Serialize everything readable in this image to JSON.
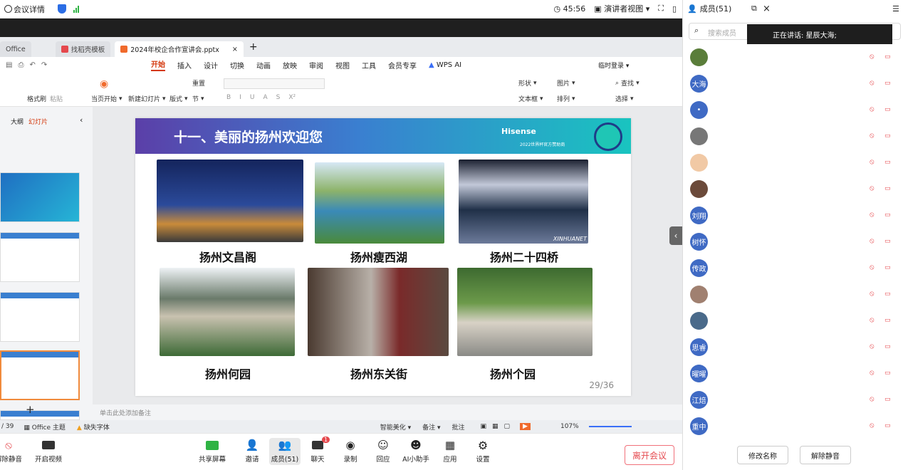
{
  "topbar": {
    "title": "会议详情",
    "timer": "45:56",
    "view_mode": "演讲者视图"
  },
  "wps": {
    "tabs": [
      {
        "label": "Office"
      },
      {
        "label": "找稻壳模板"
      },
      {
        "label": "2024年校企合作宣讲会.pptx"
      }
    ],
    "menu": [
      "开始",
      "插入",
      "设计",
      "切换",
      "动画",
      "放映",
      "审阅",
      "视图",
      "工具",
      "会员专享",
      "WPS AI"
    ],
    "account": "临时登录",
    "ribbon": {
      "format_painter": "格式刷",
      "paste": "粘贴",
      "play_from": "当页开始",
      "new_slide": "新建幻灯片",
      "layout": "版式",
      "section": "节",
      "reset": "重置",
      "shape": "形状",
      "picture": "图片",
      "textbox": "文本框",
      "arrange": "排列",
      "find": "查找",
      "select": "选择"
    },
    "panel_tabs": {
      "outline": "大纲",
      "slides": "幻灯片"
    },
    "note_placeholder": "单击此处添加备注",
    "status": {
      "page": "/ 39",
      "theme": "Office 主题",
      "missing_font": "缺失字体",
      "beautify": "智能美化",
      "notes": "备注",
      "comment": "批注",
      "zoom": "107%"
    }
  },
  "slide": {
    "title": "十一、美丽的扬州欢迎您",
    "brand": "Hisense",
    "brand_sub": "2022世界杯官方赞助商",
    "captions": [
      "扬州文昌阁",
      "扬州瘦西湖",
      "扬州二十四桥",
      "扬州何园",
      "扬州东关街",
      "扬州个园"
    ],
    "watermark": "XINHUANET",
    "page": "29/36"
  },
  "meeting_bar": {
    "buttons": [
      "解除静音",
      "开启视频",
      "共享屏幕",
      "邀请",
      "成员(51)",
      "聊天",
      "录制",
      "回应",
      "AI小助手",
      "应用",
      "设置"
    ],
    "chat_badge": "1",
    "leave": "离开会议"
  },
  "sidebar": {
    "title": "成员(51)",
    "search_placeholder": "搜索成员",
    "speaking": "正在讲话:  星辰大海;",
    "members": [
      {
        "name": "",
        "initials": "",
        "color": "#5a7d3a"
      },
      {
        "name": "",
        "initials": "大海",
        "color": "#3f6ac4"
      },
      {
        "name": "",
        "initials": "•",
        "color": "#3f6ac4"
      },
      {
        "name": "",
        "initials": "",
        "color": "#777777"
      },
      {
        "name": "",
        "initials": "",
        "color": "#f1c9a5"
      },
      {
        "name": "",
        "initials": "",
        "color": "#6b4a3a"
      },
      {
        "name": "",
        "initials": "刘翔",
        "color": "#3f6ac4"
      },
      {
        "name": "",
        "initials": "树怀",
        "color": "#3f6ac4"
      },
      {
        "name": "",
        "initials": "传政",
        "color": "#3f6ac4"
      },
      {
        "name": "",
        "initials": "",
        "color": "#a08070"
      },
      {
        "name": "",
        "initials": "",
        "color": "#4a6a8a"
      },
      {
        "name": "",
        "initials": "思睿",
        "color": "#3f6ac4"
      },
      {
        "name": "",
        "initials": "曜曜",
        "color": "#3f6ac4"
      },
      {
        "name": "",
        "initials": "江焙",
        "color": "#3f6ac4"
      },
      {
        "name": "",
        "initials": "重中",
        "color": "#3f6ac4"
      }
    ],
    "rename": "修改名称",
    "unmute": "解除静音"
  }
}
